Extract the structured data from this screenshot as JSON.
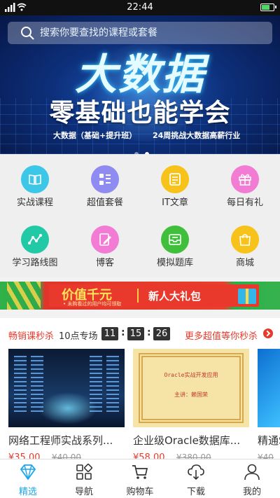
{
  "status_bar": {
    "time": "22:44"
  },
  "search": {
    "placeholder": "搜索你要查找的课程或套餐"
  },
  "banner": {
    "title": "大数据",
    "subtitle": "零基础也能学会",
    "tag_left": "大数据（基础+提升班）",
    "tag_right": "24周挑战大数据高薪行业",
    "active_dot": 1,
    "dot_count": 2
  },
  "categories": [
    {
      "label": "实战课程",
      "icon": "book-icon",
      "color": "#3cc6e8"
    },
    {
      "label": "超值套餐",
      "icon": "list-icon",
      "color": "#8e8cf0"
    },
    {
      "label": "IT文章",
      "icon": "article-icon",
      "color": "#f7c21a"
    },
    {
      "label": "每日有礼",
      "icon": "gift-icon",
      "color": "#f27bd3"
    },
    {
      "label": "学习路线图",
      "icon": "route-icon",
      "color": "#22c9a6"
    },
    {
      "label": "博客",
      "icon": "edit-icon",
      "color": "#f27bd3"
    },
    {
      "label": "模拟题库",
      "icon": "inbox-icon",
      "color": "#3fbf3b"
    },
    {
      "label": "商城",
      "icon": "bag-icon",
      "color": "#f7c21a"
    }
  ],
  "promo": {
    "headline": "价值千元",
    "note": "• 未购看过的用户均可领取",
    "gift_text": "新人大礼包"
  },
  "flash_sale": {
    "title": "畅销课秒杀",
    "session": "10点专场",
    "countdown": {
      "hours": "11",
      "minutes": "15",
      "seconds": "26"
    },
    "more_label": "更多超值等你秒杀",
    "items": [
      {
        "name": "网络工程师实战系列...",
        "price": "¥35.00",
        "old_price": "¥40.00"
      },
      {
        "name": "企业级Oracle数据库...",
        "price": "¥58.00",
        "old_price": "¥380.00",
        "cover_title": "Oracle实战开发应用",
        "cover_author": "主讲：赖国荣"
      },
      {
        "name": "精通S",
        "price": "",
        "old_price": "¥40"
      }
    ]
  },
  "tabbar": {
    "active": "精选",
    "tabs": [
      {
        "label": "精选",
        "icon": "diamond-icon"
      },
      {
        "label": "导航",
        "icon": "grid-icon"
      },
      {
        "label": "购物车",
        "icon": "cart-icon"
      },
      {
        "label": "下载",
        "icon": "cloud-download-icon"
      },
      {
        "label": "我的",
        "icon": "user-icon"
      }
    ]
  }
}
